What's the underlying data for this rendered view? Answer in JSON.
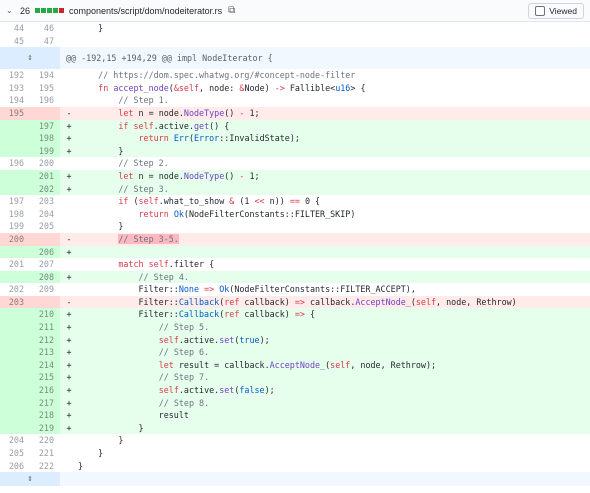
{
  "file": {
    "changes": "26",
    "path": "components/script/dom/nodeiterator.rs",
    "viewed_label": "Viewed",
    "bar_colors": [
      "#28a745",
      "#28a745",
      "#28a745",
      "#28a745",
      "#cb2431"
    ]
  },
  "hunk": "@@ -192,15 +194,29 @@ impl NodeIterator {",
  "top_rows": [
    {
      "t": "ctx",
      "o": "44",
      "n": "46",
      "s": "",
      "c": "    }"
    },
    {
      "t": "ctx",
      "o": "45",
      "n": "47",
      "s": "",
      "c": ""
    }
  ],
  "rows": [
    {
      "t": "ctx",
      "o": "192",
      "n": "194",
      "s": "",
      "c": "    // https://dom.spec.whatwg.org/#concept-node-filter"
    },
    {
      "t": "ctx",
      "o": "193",
      "n": "195",
      "s": "",
      "c": "    fn accept_node(&self, node: &Node) -> Fallible<u16> {"
    },
    {
      "t": "ctx",
      "o": "194",
      "n": "196",
      "s": "",
      "c": "        // Step 1."
    },
    {
      "t": "del",
      "o": "195",
      "n": "",
      "s": "-",
      "c": "        let n = node.NodeType() - 1;"
    },
    {
      "t": "add",
      "o": "",
      "n": "197",
      "s": "+",
      "c": "        if self.active.get() {"
    },
    {
      "t": "add",
      "o": "",
      "n": "198",
      "s": "+",
      "c": "            return Err(Error::InvalidState);"
    },
    {
      "t": "add",
      "o": "",
      "n": "199",
      "s": "+",
      "c": "        }"
    },
    {
      "t": "ctx",
      "o": "196",
      "n": "200",
      "s": "",
      "c": "        // Step 2."
    },
    {
      "t": "add",
      "o": "",
      "n": "201",
      "s": "+",
      "c": "        let n = node.NodeType() - 1;"
    },
    {
      "t": "add",
      "o": "",
      "n": "202",
      "s": "+",
      "c": "        // Step 3."
    },
    {
      "t": "ctx",
      "o": "197",
      "n": "203",
      "s": "",
      "c": "        if (self.what_to_show & (1 << n)) == 0 {"
    },
    {
      "t": "ctx",
      "o": "198",
      "n": "204",
      "s": "",
      "c": "            return Ok(NodeFilterConstants::FILTER_SKIP)"
    },
    {
      "t": "ctx",
      "o": "199",
      "n": "205",
      "s": "",
      "c": "        }"
    },
    {
      "t": "del",
      "o": "200",
      "n": "",
      "s": "-",
      "c": "        // Step 3-5."
    },
    {
      "t": "add",
      "o": "",
      "n": "206",
      "s": "+",
      "c": ""
    },
    {
      "t": "ctx",
      "o": "201",
      "n": "207",
      "s": "",
      "c": "        match self.filter {"
    },
    {
      "t": "add",
      "o": "",
      "n": "208",
      "s": "+",
      "c": "            // Step 4."
    },
    {
      "t": "ctx",
      "o": "202",
      "n": "209",
      "s": "",
      "c": "            Filter::None => Ok(NodeFilterConstants::FILTER_ACCEPT),"
    },
    {
      "t": "del",
      "o": "203",
      "n": "",
      "s": "-",
      "c": "            Filter::Callback(ref callback) => callback.AcceptNode_(self, node, Rethrow)"
    },
    {
      "t": "add",
      "o": "",
      "n": "210",
      "s": "+",
      "c": "            Filter::Callback(ref callback) => {"
    },
    {
      "t": "add",
      "o": "",
      "n": "211",
      "s": "+",
      "c": "                // Step 5."
    },
    {
      "t": "add",
      "o": "",
      "n": "212",
      "s": "+",
      "c": "                self.active.set(true);"
    },
    {
      "t": "add",
      "o": "",
      "n": "213",
      "s": "+",
      "c": "                // Step 6."
    },
    {
      "t": "add",
      "o": "",
      "n": "214",
      "s": "+",
      "c": "                let result = callback.AcceptNode_(self, node, Rethrow);"
    },
    {
      "t": "add",
      "o": "",
      "n": "215",
      "s": "+",
      "c": "                // Step 7."
    },
    {
      "t": "add",
      "o": "",
      "n": "216",
      "s": "+",
      "c": "                self.active.set(false);"
    },
    {
      "t": "add",
      "o": "",
      "n": "217",
      "s": "+",
      "c": "                // Step 8."
    },
    {
      "t": "add",
      "o": "",
      "n": "218",
      "s": "+",
      "c": "                result"
    },
    {
      "t": "add",
      "o": "",
      "n": "219",
      "s": "+",
      "c": "            }"
    },
    {
      "t": "ctx",
      "o": "204",
      "n": "220",
      "s": "",
      "c": "        }"
    },
    {
      "t": "ctx",
      "o": "205",
      "n": "221",
      "s": "",
      "c": "    }"
    },
    {
      "t": "ctx",
      "o": "206",
      "n": "222",
      "s": "",
      "c": "}"
    }
  ]
}
